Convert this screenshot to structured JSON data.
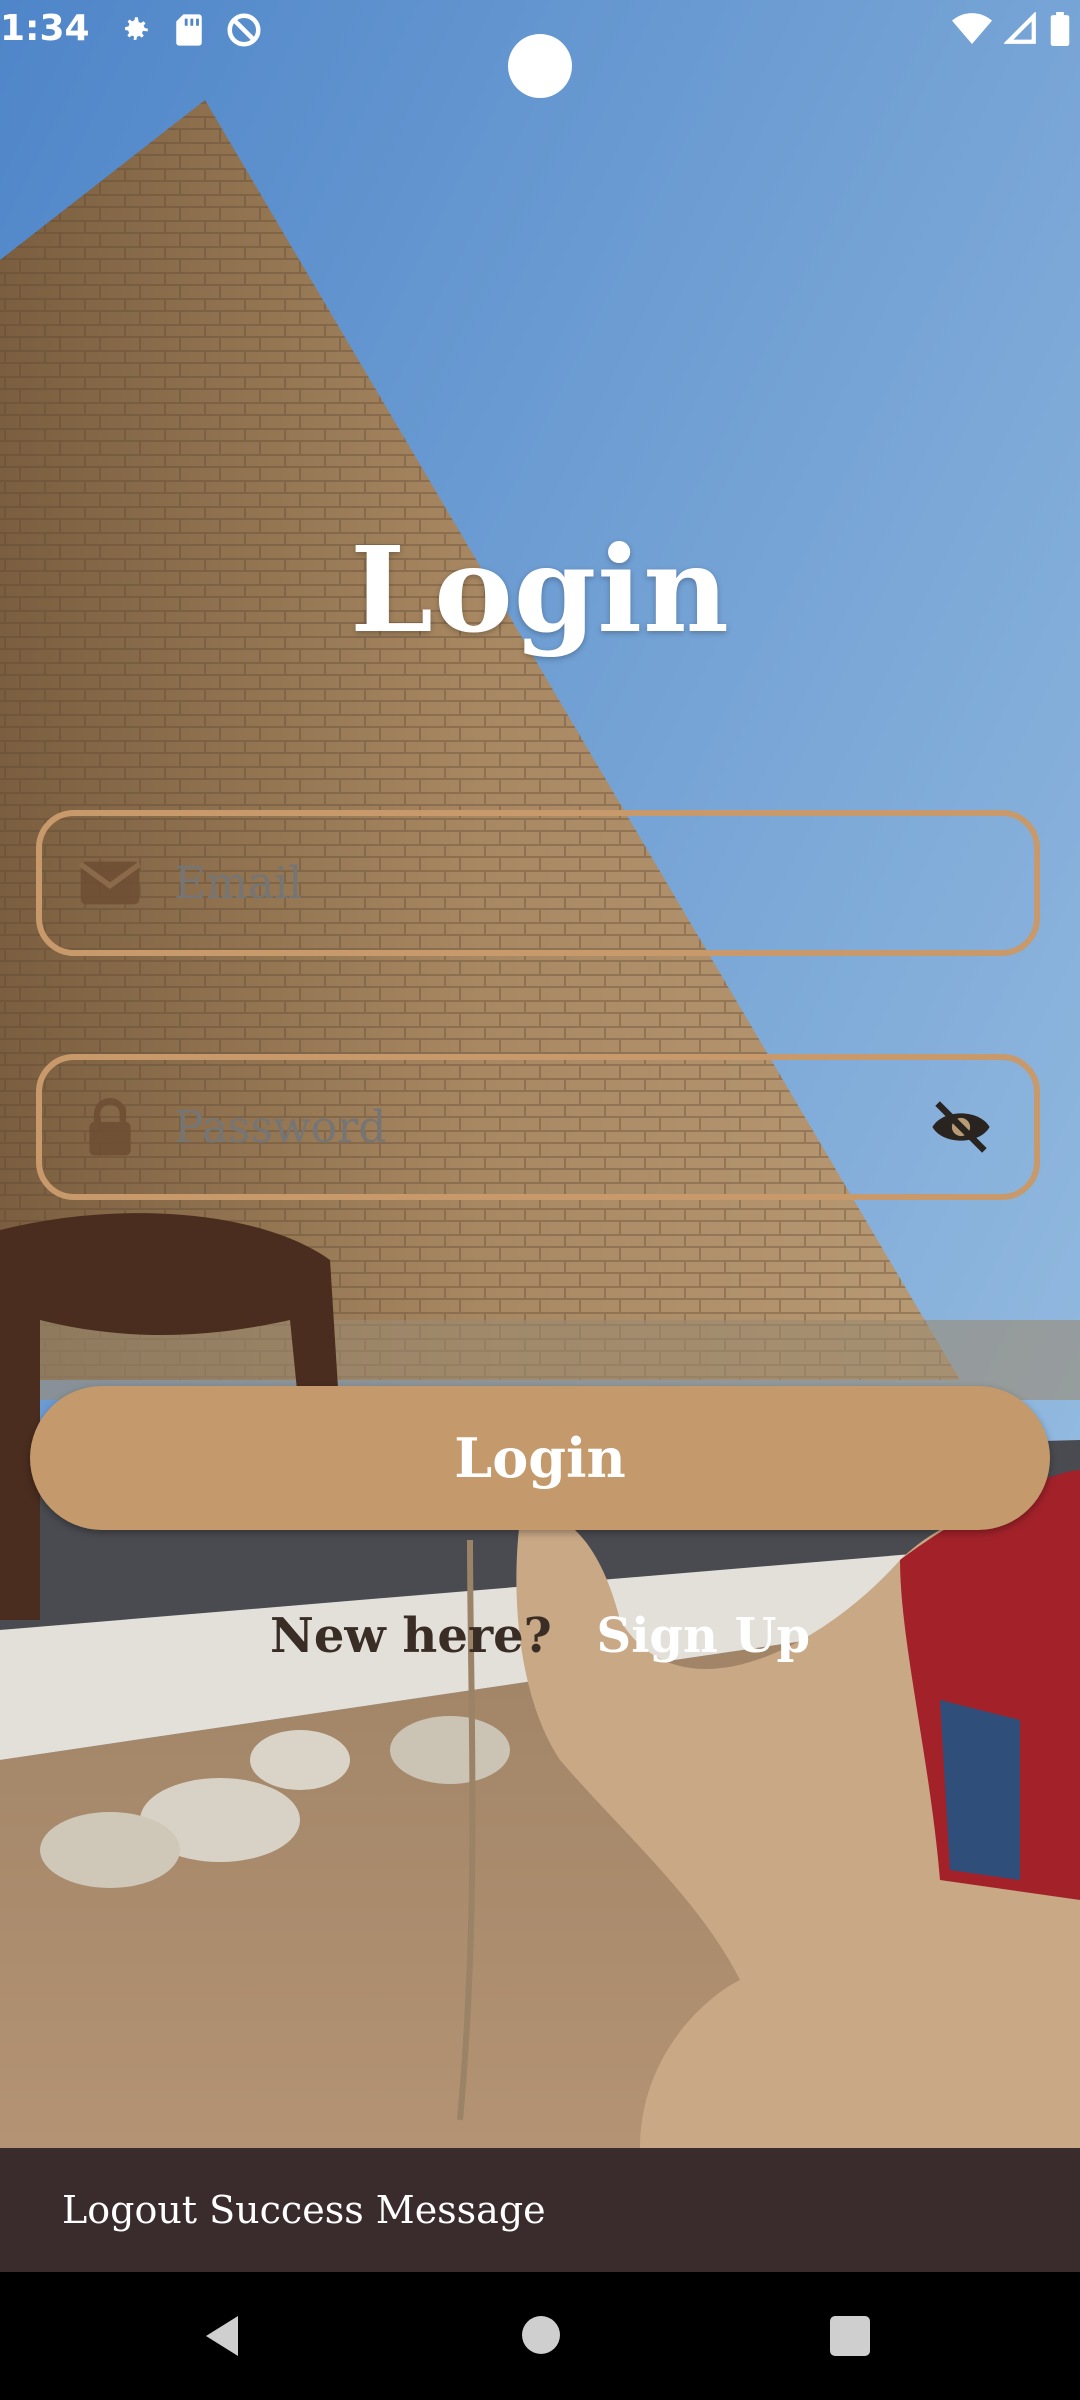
{
  "status_bar": {
    "time": "1:34",
    "left_icons": [
      "settings-icon",
      "sd-card-icon",
      "do-not-disturb-icon"
    ],
    "right_icons": [
      "wifi-icon",
      "cell-signal-icon",
      "battery-icon"
    ]
  },
  "title": "Login",
  "email_field": {
    "placeholder": "Email",
    "icon": "email-icon"
  },
  "password_field": {
    "placeholder": "Password",
    "icon": "lock-icon",
    "toggle_icon": "visibility-off-icon"
  },
  "login_button": {
    "label": "Login",
    "color": "#c4996c"
  },
  "signup": {
    "prompt": "New here?",
    "link_label": "Sign Up"
  },
  "snackbar": {
    "message": "Logout Success Message"
  },
  "nav": {
    "icons": [
      "back-icon",
      "home-icon",
      "recents-icon"
    ]
  },
  "colors": {
    "accent": "#c8996a",
    "snackbar_bg": "#3a2c2c",
    "prompt_text": "#3a2d25"
  }
}
